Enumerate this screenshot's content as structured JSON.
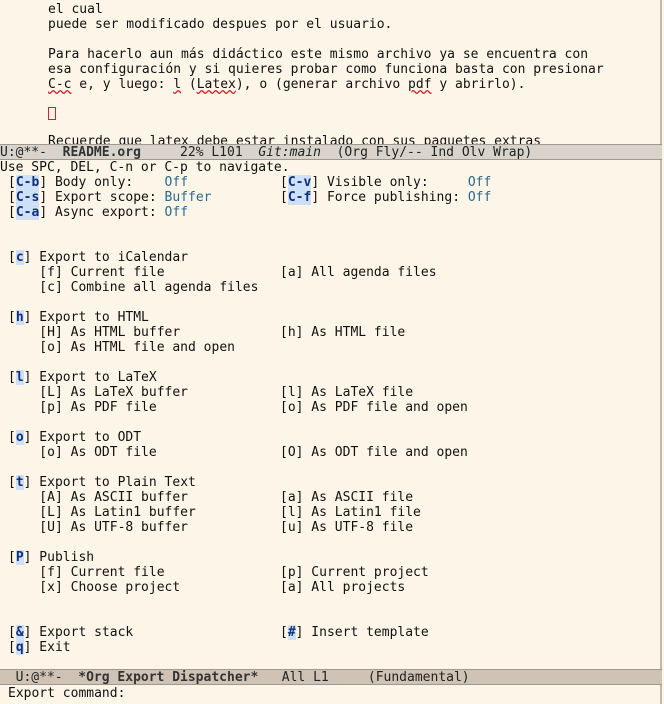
{
  "document": {
    "lines": [
      "el cual",
      "puede ser modificado despues por el usuario.",
      "",
      "Para hacerlo aun más didáctico este mismo archivo ya se encuentra con",
      "esa configuración y si quieres probar como funciona basta con presionar"
    ],
    "line6_prefix": "C-c",
    "line6_mid": " e, y luego: ",
    "line6_l": "l",
    "line6_paren1": " (",
    "line6_latex": "Latex",
    "line6_rest": "), o (generar archivo ",
    "line6_pdf": "pdf",
    "line6_end": " y abrirlo).",
    "partial_line": "Recuerde que latex debe estar instalado con sus paquetes extras"
  },
  "top_modeline": {
    "state": "U:@**-  ",
    "buffer": "README.org",
    "position": "     22% L101  ",
    "git": "Git:main",
    "modes": "  (Org Fly/-- Ind Olv Wrap)"
  },
  "help_line": "Use SPC, DEL, C-n or C-p to navigate.",
  "options": {
    "body_key": "C-b",
    "body_label": " Body only:    ",
    "body_val": "Off",
    "visible_key": "C-v",
    "visible_label": " Visible only:     ",
    "visible_val": "Off",
    "scope_key": "C-s",
    "scope_label": " Export scope: ",
    "scope_val": "Buffer",
    "force_key": "C-f",
    "force_label": " Force publishing: ",
    "force_val": "Off",
    "async_key": "C-a",
    "async_label": " Async export: ",
    "async_val": "Off"
  },
  "sections": {
    "ical": {
      "key": "c",
      "title": " Export to iCalendar",
      "l1": "    [f] Current file",
      "r1": "[a] All agenda files",
      "l2": "    [c] Combine all agenda files"
    },
    "html": {
      "key": "h",
      "title": " Export to HTML",
      "l1": "    [H] As HTML buffer",
      "r1": "[h] As HTML file",
      "l2": "    [o] As HTML file and open"
    },
    "latex": {
      "key": "l",
      "title": " Export to LaTeX",
      "l1": "    [L] As LaTeX buffer",
      "r1": "[l] As LaTeX file",
      "l2": "    [p] As PDF file",
      "r2": "[o] As PDF file and open"
    },
    "odt": {
      "key": "o",
      "title": " Export to ODT",
      "l1": "    [o] As ODT file",
      "r1": "[O] As ODT file and open"
    },
    "text": {
      "key": "t",
      "title": " Export to Plain Text",
      "l1": "    [A] As ASCII buffer",
      "r1": "[a] As ASCII file",
      "l2": "    [L] As Latin1 buffer",
      "r2": "[l] As Latin1 file",
      "l3": "    [U] As UTF-8 buffer",
      "r3": "[u] As UTF-8 file"
    },
    "publish": {
      "key": "P",
      "title": " Publish",
      "l1": "    [f] Current file",
      "r1": "[p] Current project",
      "l2": "    [x] Choose project",
      "r2": "[a] All projects"
    },
    "stack": {
      "key": "&",
      "title": " Export stack",
      "r_key": "#",
      "r_title": " Insert template"
    },
    "exit": {
      "key": "q",
      "title": " Exit"
    }
  },
  "bottom_modeline": {
    "state": "U:@**-  ",
    "buffer": "*Org Export Dispatcher*",
    "position": "   All L1     ",
    "modes": "(Fundamental)"
  },
  "minibuffer": "Export command: "
}
